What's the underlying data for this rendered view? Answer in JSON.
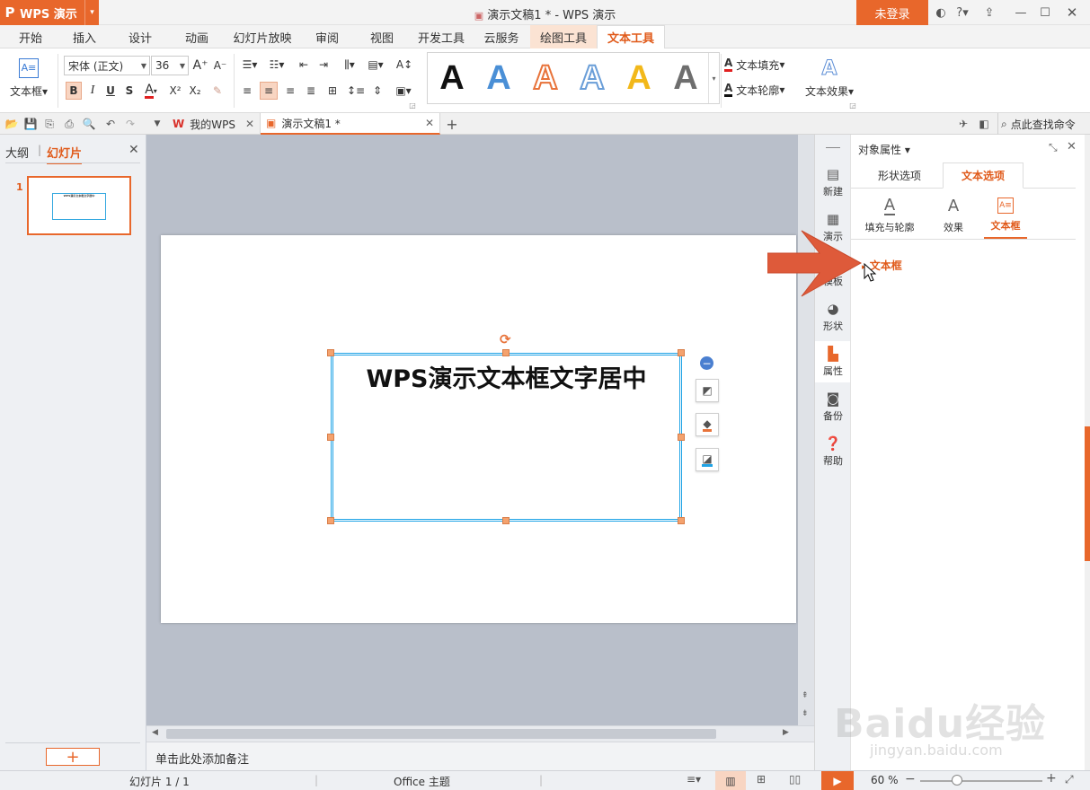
{
  "titlebar": {
    "app_name": "WPS 演示",
    "doc_title": "演示文稿1 * - WPS 演示",
    "login": "未登录",
    "help": "?"
  },
  "tabs": [
    {
      "label": "开始"
    },
    {
      "label": "插入"
    },
    {
      "label": "设计"
    },
    {
      "label": "动画"
    },
    {
      "label": "幻灯片放映"
    },
    {
      "label": "审阅"
    },
    {
      "label": "视图"
    },
    {
      "label": "开发工具"
    },
    {
      "label": "云服务"
    },
    {
      "label": "绘图工具"
    },
    {
      "label": "文本工具"
    }
  ],
  "ribbon": {
    "textbox": "文本框",
    "font_name": "宋体 (正文)",
    "font_size": "36",
    "bold": "B",
    "italic": "I",
    "underline": "U",
    "strike": "S",
    "font_color": "A",
    "superscript": "X²",
    "subscript": "X₂",
    "grow": "A⁺",
    "shrink": "A⁻",
    "wordart_letter": "A",
    "fill": "文本填充",
    "outline": "文本轮廓",
    "effect": "文本效果"
  },
  "quick": {
    "search": "点此查找命令"
  },
  "doctabs": [
    {
      "label": "我的WPS"
    },
    {
      "label": "演示文稿1 *"
    }
  ],
  "leftpane": {
    "outline_tab": "大纲",
    "slides_tab": "幻灯片",
    "slide_number": "1"
  },
  "slide": {
    "text": "WPS演示文本框文字居中"
  },
  "notes": {
    "placeholder": "单击此处添加备注"
  },
  "sidebar": [
    {
      "label": "新建"
    },
    {
      "label": "演示"
    },
    {
      "label": "模板"
    },
    {
      "label": "形状"
    },
    {
      "label": "属性"
    },
    {
      "label": "备份"
    },
    {
      "label": "帮助"
    }
  ],
  "panel": {
    "title": "对象属性",
    "tab_shape": "形状选项",
    "tab_text": "文本选项",
    "sub_fill": "填充与轮廓",
    "sub_effect": "效果",
    "sub_textbox": "文本框",
    "section": "文本框"
  },
  "status": {
    "slide": "幻灯片 1 / 1",
    "theme": "Office 主题",
    "zoom": "60 %"
  },
  "watermark": {
    "brand": "Baidu经验",
    "url": "jingyan.baidu.com"
  },
  "colors": {
    "accent": "#e8672b",
    "selection": "#1fa3e6"
  }
}
